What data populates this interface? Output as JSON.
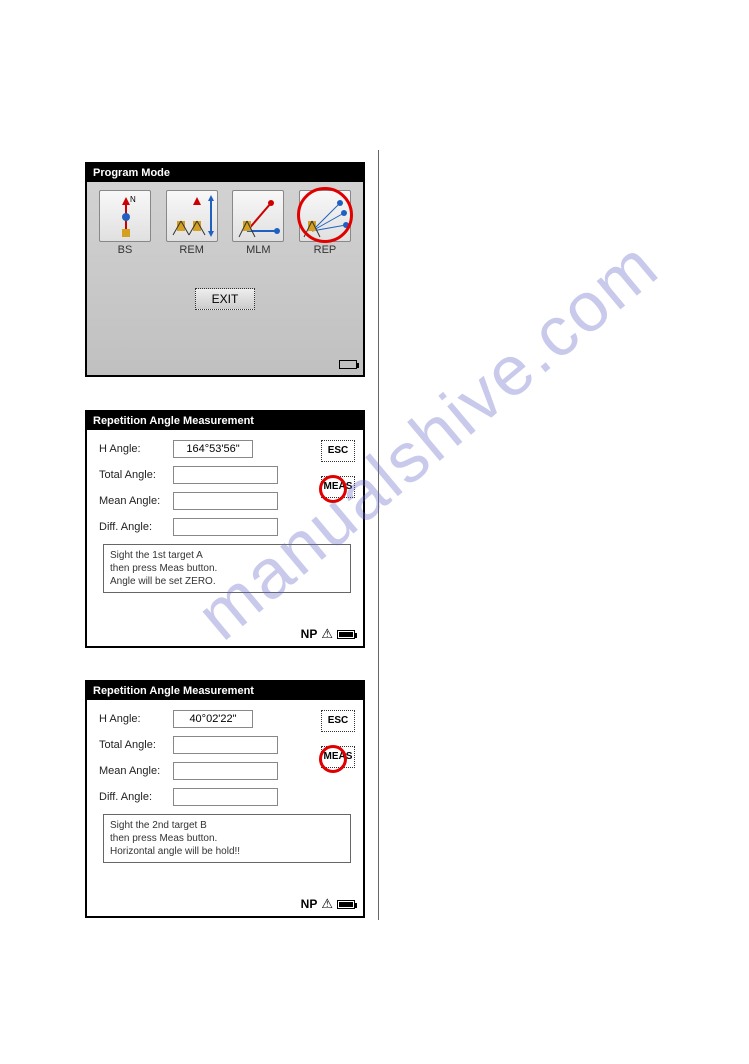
{
  "watermark": "manualshive.com",
  "program_mode": {
    "title": "Program Mode",
    "items": [
      {
        "label": "BS"
      },
      {
        "label": "REM"
      },
      {
        "label": "MLM"
      },
      {
        "label": "REP"
      }
    ],
    "exit_label": "EXIT"
  },
  "panel2": {
    "title": "Repetition Angle Measurement",
    "fields": {
      "h_angle_label": "H Angle:",
      "h_angle_value": "164°53'56\"",
      "total_angle_label": "Total Angle:",
      "total_angle_value": "",
      "mean_angle_label": "Mean Angle:",
      "mean_angle_value": "",
      "diff_angle_label": "Diff. Angle:",
      "diff_angle_value": ""
    },
    "buttons": {
      "esc": "ESC",
      "meas": "MEAS"
    },
    "instruction": "Sight the 1st target A\nthen press Meas button.\nAngle will be set ZERO.",
    "status": {
      "np": "NP"
    }
  },
  "panel3": {
    "title": "Repetition Angle Measurement",
    "fields": {
      "h_angle_label": "H Angle:",
      "h_angle_value": "40°02'22\"",
      "total_angle_label": "Total Angle:",
      "total_angle_value": "",
      "mean_angle_label": "Mean Angle:",
      "mean_angle_value": "",
      "diff_angle_label": "Diff. Angle:",
      "diff_angle_value": ""
    },
    "buttons": {
      "esc": "ESC",
      "meas": "MEAS"
    },
    "instruction": "Sight the 2nd target B\nthen press Meas button.\nHorizontal angle will be hold!!",
    "status": {
      "np": "NP"
    }
  }
}
